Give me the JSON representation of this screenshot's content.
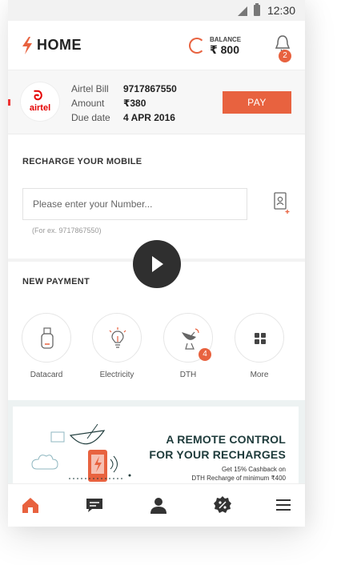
{
  "status_bar": {
    "time": "12:30"
  },
  "header": {
    "title": "HOME",
    "balance_label": "BALANCE",
    "balance_value": "₹ 800",
    "notifications_count": "2",
    "accent_color": "#e8623f"
  },
  "bill": {
    "brand": "airtel",
    "rows": [
      {
        "label": "Airtel Bill",
        "value": "9717867550"
      },
      {
        "label": "Amount",
        "value": "₹380"
      },
      {
        "label": "Due date",
        "value": "4 APR 2016"
      }
    ],
    "pay_label": "PAY"
  },
  "recharge": {
    "title": "RECHARGE YOUR MOBILE",
    "placeholder": "Please enter your Number...",
    "hint": "(For ex. 9717867550)",
    "contact_icon": "contact-book-icon"
  },
  "video": {
    "icon": "play-icon"
  },
  "new_payment": {
    "title": "NEW PAYMENT",
    "items": [
      {
        "label": "Datacard",
        "icon": "usb-datacard-icon"
      },
      {
        "label": "Electricity",
        "icon": "bulb-icon"
      },
      {
        "label": "DTH",
        "icon": "satellite-dish-icon",
        "badge": "4"
      },
      {
        "label": "More",
        "icon": "grid-icon"
      }
    ]
  },
  "banner": {
    "headline_1": "A REMOTE CONTROL",
    "headline_2": "FOR YOUR RECHARGES",
    "sub_1": "Get 15% Cashback on",
    "sub_2": "DTH Recharge of minimum ₹400"
  },
  "bottom_nav": [
    {
      "icon": "home-icon",
      "active": true
    },
    {
      "icon": "chat-icon"
    },
    {
      "icon": "profile-icon"
    },
    {
      "icon": "offers-icon"
    },
    {
      "icon": "menu-icon"
    }
  ]
}
